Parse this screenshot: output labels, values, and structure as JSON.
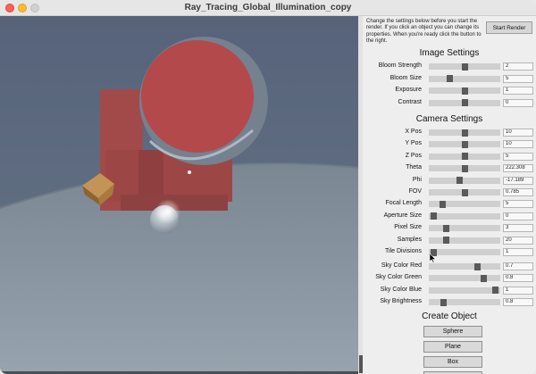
{
  "window": {
    "title": "Ray_Tracing_Global_Illumination_copy"
  },
  "panel": {
    "intro_text": "Change the settings below before you start the render. If you click an object you can change its properties. When you're ready click the button to the right.",
    "start_button": "Start Render",
    "image_settings": {
      "title": "Image Settings",
      "rows": [
        {
          "label": "Bloom Strength",
          "value": "2",
          "level": 0.5
        },
        {
          "label": "Bloom Size",
          "value": "5",
          "level": 0.28
        },
        {
          "label": "Exposure",
          "value": "1",
          "level": 0.5
        },
        {
          "label": "Contrast",
          "value": "0",
          "level": 0.5
        }
      ]
    },
    "camera_settings": {
      "title": "Camera Settings",
      "rows": [
        {
          "label": "X Pos",
          "value": "10",
          "level": 0.5
        },
        {
          "label": "Y Pos",
          "value": "10",
          "level": 0.5
        },
        {
          "label": "Z Pos",
          "value": "5",
          "level": 0.5
        },
        {
          "label": "Theta",
          "value": "222.308",
          "level": 0.5
        },
        {
          "label": "Phi",
          "value": "-17.189",
          "level": 0.42
        },
        {
          "label": "FOV",
          "value": "0.785",
          "level": 0.5
        },
        {
          "label": "Focal Length",
          "value": "5",
          "level": 0.17
        },
        {
          "label": "Aperture Size",
          "value": "0",
          "level": 0.03
        },
        {
          "label": "Pixel Size",
          "value": "3",
          "level": 0.22
        },
        {
          "label": "Samples",
          "value": "20",
          "level": 0.22
        },
        {
          "label": "Tile Divisions",
          "value": "1",
          "level": 0.03
        }
      ]
    },
    "sky_settings": {
      "rows": [
        {
          "label": "Sky Color Red",
          "value": "0.7",
          "level": 0.7
        },
        {
          "label": "Sky Color Green",
          "value": "0.8",
          "level": 0.8
        },
        {
          "label": "Sky Color Blue",
          "value": "1",
          "level": 0.97
        },
        {
          "label": "Sky Brightness",
          "value": "0.8",
          "level": 0.18
        }
      ]
    },
    "create_object": {
      "title": "Create Object",
      "buttons": [
        "Sphere",
        "Plane",
        "Box"
      ]
    }
  },
  "colors": {
    "sky": "#5d6a7d",
    "ground": "#7f8c97",
    "red_object": "#a14b4b",
    "red_sphere": "#b54b4b",
    "cube": "#a8793c"
  }
}
